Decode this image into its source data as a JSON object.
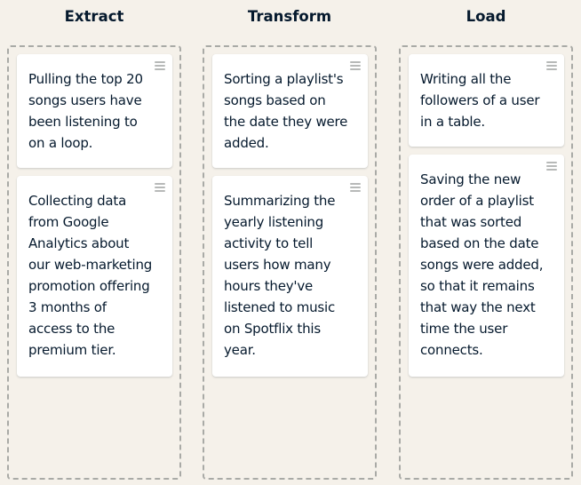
{
  "columns": [
    {
      "title": "Extract",
      "cards": [
        {
          "text": "Pulling the top 20\nsongs users have\nbeen listening to\non a loop."
        },
        {
          "text": "Collecting data\nfrom Google\nAnalytics about\nour web-marketing\npromotion offering\n3 months of\naccess to the\npremium tier."
        }
      ]
    },
    {
      "title": "Transform",
      "cards": [
        {
          "text": "Sorting a playlist's\nsongs based on\nthe date they were\nadded."
        },
        {
          "text": "Summarizing the\nyearly listening\nactivity to tell\nusers how many\nhours they've\nlistened to music\non Spotflix this\nyear."
        }
      ]
    },
    {
      "title": "Load",
      "cards": [
        {
          "text": "Writing all the\nfollowers of a user\nin a table."
        },
        {
          "text": "Saving the new\norder of a playlist\nthat was sorted\nbased on the date\nsongs were added,\nso that it remains\nthat way the next\ntime the user\nconnects."
        }
      ]
    }
  ],
  "icons": {
    "drag_handle": "drag-handle-icon"
  }
}
